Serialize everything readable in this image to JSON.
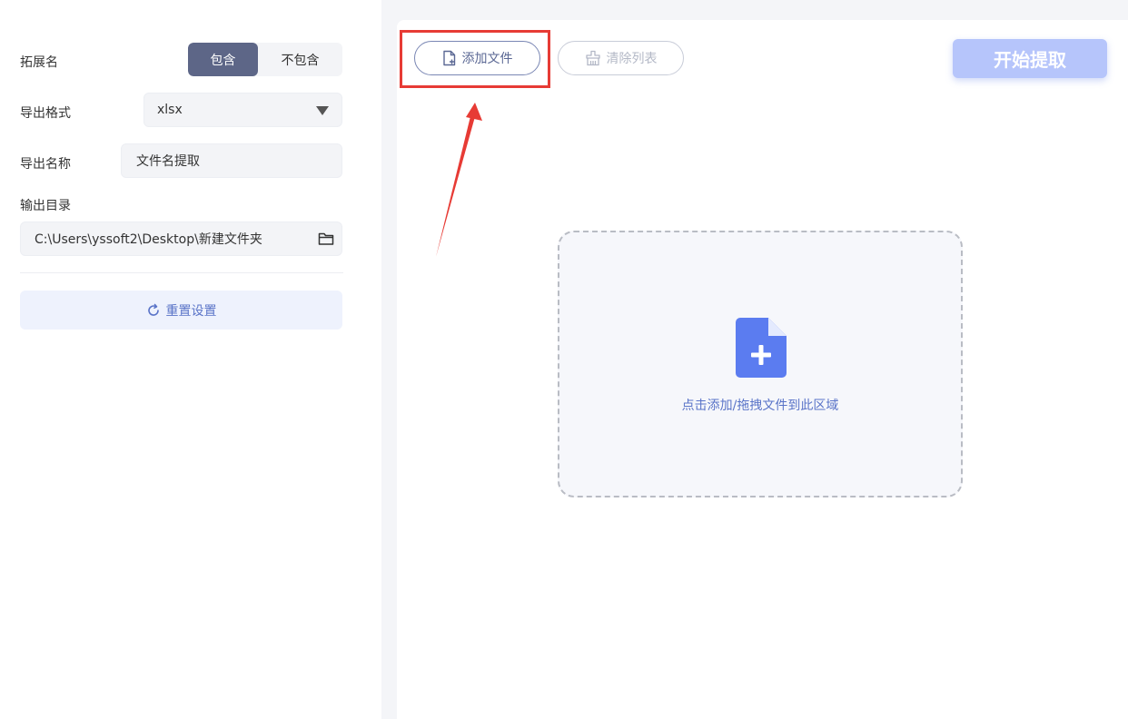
{
  "settings": {
    "extension_label": "拓展名",
    "extension_options": [
      "包含",
      "不包含"
    ],
    "format_label": "导出格式",
    "format_value": "xlsx",
    "name_label": "导出名称",
    "name_value": "文件名提取",
    "dir_label": "输出目录",
    "dir_value": "C:\\Users\\yssoft2\\Desktop\\新建文件夹",
    "reset_label": "重置设置"
  },
  "toolbar": {
    "add_file_label": "添加文件",
    "clear_list_label": "清除列表",
    "start_label": "开始提取"
  },
  "dropzone": {
    "hint": "点击添加/拖拽文件到此区域"
  },
  "colors": {
    "accent": "#5b7cf0",
    "start_button": "#b6c5fb",
    "highlight": "#e73b35"
  }
}
